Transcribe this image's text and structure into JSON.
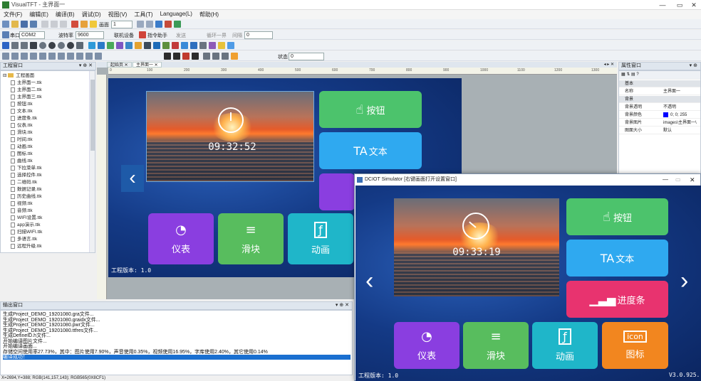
{
  "app": {
    "title": "VisualTFT - 主界面一",
    "window_controls": [
      "—",
      "▭",
      "✕"
    ]
  },
  "menu": [
    "文件(F)",
    "编辑(E)",
    "编译(B)",
    "调试(D)",
    "视图(V)",
    "工具(T)",
    "Language(L)",
    "帮助(H)"
  ],
  "toolbar": {
    "screen_label": "画面",
    "screen_index": "1",
    "port_label": "串口",
    "port_value": "COM2",
    "baud_label": "波特率",
    "baud_value": "9600",
    "connect_button": "联机设备",
    "cmd_helper": "指令助手",
    "send_label": "发送",
    "cycle_label": "循环一界",
    "interval_label": "间隔",
    "interval_value": "0",
    "state_label": "状态",
    "state_value": "0"
  },
  "project_panel": {
    "title": "工程窗口",
    "root": "工程画面",
    "files": [
      "主界面一.ttk",
      "主界面二.ttk",
      "主界面三.ttk",
      "按钮.ttk",
      "文本.ttk",
      "进度条.ttk",
      "仪表.ttk",
      "滑块.ttk",
      "时间.ttk",
      "动画.ttk",
      "图标.ttk",
      "曲线.ttk",
      "下拉菜单.ttk",
      "选择控件.ttk",
      "二维码.ttk",
      "数据记录.ttk",
      "历史曲线.ttk",
      "视频.ttk",
      "音频.ttk",
      "WIFI设置.ttk",
      "app演示.ttk",
      "扫描WIFI.ttk",
      "多语言.ttk",
      "远程升级.ttk"
    ]
  },
  "tabs": {
    "start": "起始页",
    "active": "主界面一"
  },
  "ruler_marks": [
    "0",
    "100",
    "200",
    "300",
    "400",
    "500",
    "600",
    "700",
    "800",
    "900",
    "1000",
    "1100",
    "1200",
    "1300"
  ],
  "design": {
    "time": "09:32:52",
    "buttons": {
      "button": "按钮",
      "text": "文本",
      "meter": "仪表",
      "slider": "滑块",
      "animation": "动画"
    },
    "version": "工程版本: 1.0"
  },
  "properties": {
    "title": "属性窗口",
    "section1": "基本",
    "name_key": "名称",
    "name_value": "主界面一",
    "section2": "背景",
    "rows": [
      {
        "k": "背景透明",
        "v": "不透明"
      },
      {
        "k": "背景颜色",
        "v": "0; 0; 255"
      },
      {
        "k": "背景图片",
        "v": "images\\主界面一\\"
      },
      {
        "k": "图面大小",
        "v": "默认"
      }
    ],
    "bgcolor": "#0000ff"
  },
  "output": {
    "title": "输出窗口",
    "lines": [
      "生成Project_DEMO_19201080.gra文件...",
      "生成Project_DEMO_19201080.graidx文件...",
      "生成Project_DEMO_19201080.pwr文件...",
      "生成Project_DEMO_19201080.ttfres文件...",
      "生成DefineID.h文件...",
      "开始编译图片文件...",
      "开始编译画面...",
      "存储空间使用率27.73%，其中：图片使用7.90%，声音使用0.35%，视频使用16.95%，字库使用2.40%，其它使用0.14%",
      "编译成功！"
    ]
  },
  "statusbar": "X=2694,Y=388; RGB(141,157,143); RGB565(0X8CF1)",
  "simulator": {
    "title": "DCIOT Simulator [右键画面打开设置窗口]",
    "time": "09:33:19",
    "buttons": {
      "button": "按钮",
      "text": "文本",
      "progress": "进度条",
      "meter": "仪表",
      "slider": "滑块",
      "animation": "动画",
      "icon": "图标",
      "icon_box": "icon"
    },
    "version": "工程版本: 1.0",
    "build": "V3.0.925."
  },
  "colors": {
    "green": "#4cc36c",
    "cyan": "#2fa9f0",
    "pink": "#e8336f",
    "purple": "#8a3ee0",
    "slider_green": "#58bd5e",
    "teal": "#1fb6c9",
    "orange": "#f2861f"
  }
}
